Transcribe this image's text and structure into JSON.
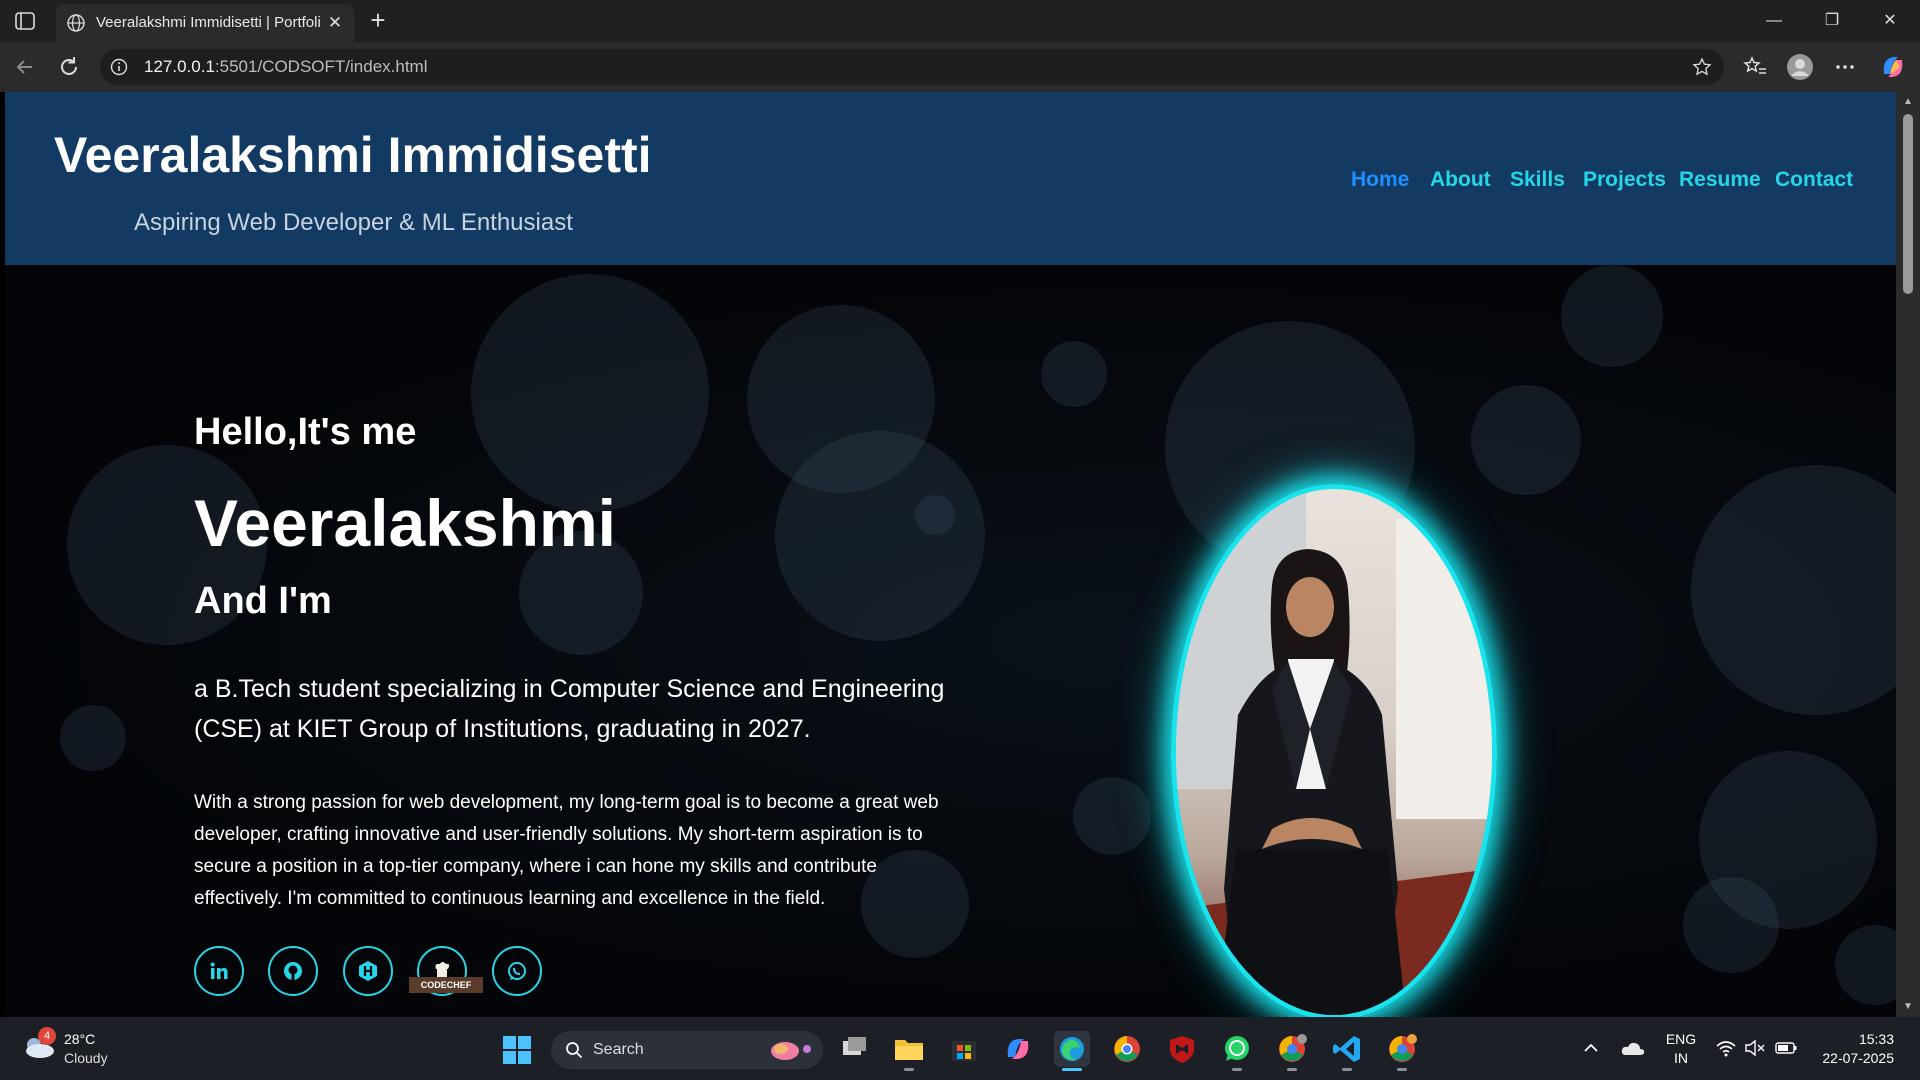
{
  "browser": {
    "tab_title": "Veeralakshmi Immidisetti | Portfolio",
    "tab_close": "✕",
    "new_tab": "+",
    "url_host": "127.0.0.1",
    "url_rest": ":5501/CODSOFT/index.html",
    "window_controls": [
      "—",
      "❐",
      "✕"
    ]
  },
  "site": {
    "title": "Veeralakshmi Immidisetti",
    "subtitle": "Aspiring Web Developer & ML Enthusiast",
    "nav": [
      "Home",
      "About",
      "Skills",
      "Projects",
      "Resume",
      "Contact"
    ],
    "active_nav": "Home",
    "accent": "#26d6e6",
    "active_color": "#1e90ff",
    "header_bg": "#123a63"
  },
  "hero": {
    "greeting": "Hello,It's me",
    "name": "Veeralakshmi",
    "and_im": "And I'm",
    "intro": "a B.Tech student specializing in Computer Science and Engineering (CSE) at KIET Group of Institutions, graduating in 2027.",
    "passion": "With a strong passion for web development, my long-term goal is to become a great web developer, crafting innovative and user-friendly solutions. My short-term aspiration is to secure a position in a top-tier company, where i can hone my skills and contribute effectively. I'm committed to continuous learning and excellence in the field.",
    "social_icons": [
      "linkedin-icon",
      "github-icon",
      "hackerrank-icon",
      "codechef-icon",
      "whatsapp-icon"
    ],
    "codechef_label": "CODECHEF"
  },
  "taskbar": {
    "weather_temp": "28°C",
    "weather_desc": "Cloudy",
    "weather_badge": "4",
    "search_label": "Search",
    "lang_top": "ENG",
    "lang_bottom": "IN",
    "time": "15:33",
    "date": "22-07-2025"
  }
}
